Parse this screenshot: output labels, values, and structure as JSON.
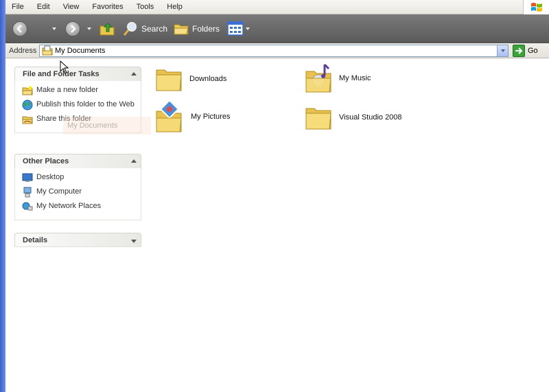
{
  "menu": [
    "File",
    "Edit",
    "View",
    "Favorites",
    "Tools",
    "Help"
  ],
  "toolbar": {
    "search_label": "Search",
    "folders_label": "Folders"
  },
  "address": {
    "label": "Address",
    "value": "My Documents",
    "go_label": "Go"
  },
  "panels": {
    "tasks": {
      "title": "File and Folder Tasks",
      "items": [
        "Make a new folder",
        "Publish this folder to the Web",
        "Share this folder"
      ]
    },
    "places": {
      "title": "Other Places",
      "items": [
        "Desktop",
        "My Computer",
        "My Network Places"
      ]
    },
    "details": {
      "title": "Details"
    }
  },
  "drag_ghost": "My Documents",
  "folders": [
    "Downloads",
    "My Music",
    "My Pictures",
    "Visual Studio 2008"
  ],
  "colors": {
    "toolbar": "#6a6a6a",
    "folder": "#f5d677",
    "accent": "#3a5fcd"
  }
}
